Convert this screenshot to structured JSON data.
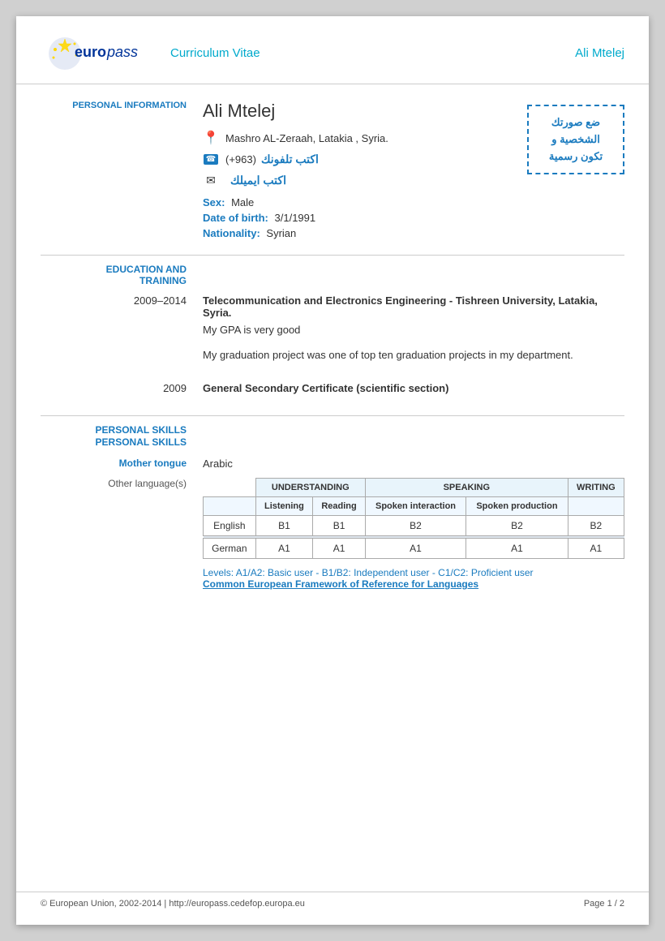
{
  "header": {
    "cv_title": "Curriculum Vitae",
    "candidate_name": "Ali Mtelej"
  },
  "personal": {
    "name": "Ali Mtelej",
    "address": "Mashro AL-Zeraah, Latakia , Syria.",
    "phone_placeholder": "اكتب تلفونك",
    "phone_prefix": "(+963)",
    "email_placeholder": "اكتب ايميلك",
    "sex_label": "Sex:",
    "sex_value": "Male",
    "dob_label": "Date of birth:",
    "dob_value": "3/1/1991",
    "nationality_label": "Nationality:",
    "nationality_value": "Syrian",
    "section_label": "PERSONAL INFORMATION",
    "photo_placeholder_line1": "ضع صورتك الشخصية و",
    "photo_placeholder_line2": "تكون رسمية"
  },
  "education": {
    "section_label": "EDUCATION AND\nTRAINING",
    "entries": [
      {
        "years": "2009–2014",
        "title": "Telecommunication and Electronics Engineering - Tishreen University, Latakia, Syria.",
        "notes": [
          "My GPA is very good",
          "My graduation project was one of top ten graduation projects in my department."
        ]
      },
      {
        "years": "2009",
        "title": "General Secondary Certificate (scientific section)",
        "notes": []
      }
    ]
  },
  "skills": {
    "section_label": "PERSONAL SKILLS",
    "mother_tongue_label": "Mother tongue",
    "mother_tongue_value": "Arabic",
    "other_languages_label": "Other language(s)",
    "language_table": {
      "col_groups": [
        {
          "label": "UNDERSTANDING",
          "colspan": 2
        },
        {
          "label": "SPEAKING",
          "colspan": 2
        },
        {
          "label": "WRITING",
          "colspan": 1
        }
      ],
      "sub_headers": [
        "Listening",
        "Reading",
        "Spoken interaction",
        "Spoken production",
        ""
      ],
      "rows": [
        {
          "language": "English",
          "values": [
            "B1",
            "B1",
            "B2",
            "B2",
            "B2"
          ]
        },
        {
          "language": "German",
          "values": [
            "A1",
            "A1",
            "A1",
            "A1",
            "A1"
          ]
        }
      ]
    },
    "levels_note": "Levels: A1/A2: Basic user - B1/B2: Independent user - C1/C2: Proficient user",
    "levels_link_text": "Common European Framework of Reference for Languages"
  },
  "footer": {
    "copyright": "© European Union, 2002-2014 | http://europass.cedefop.europa.eu",
    "page": "Page  1 / 2"
  }
}
